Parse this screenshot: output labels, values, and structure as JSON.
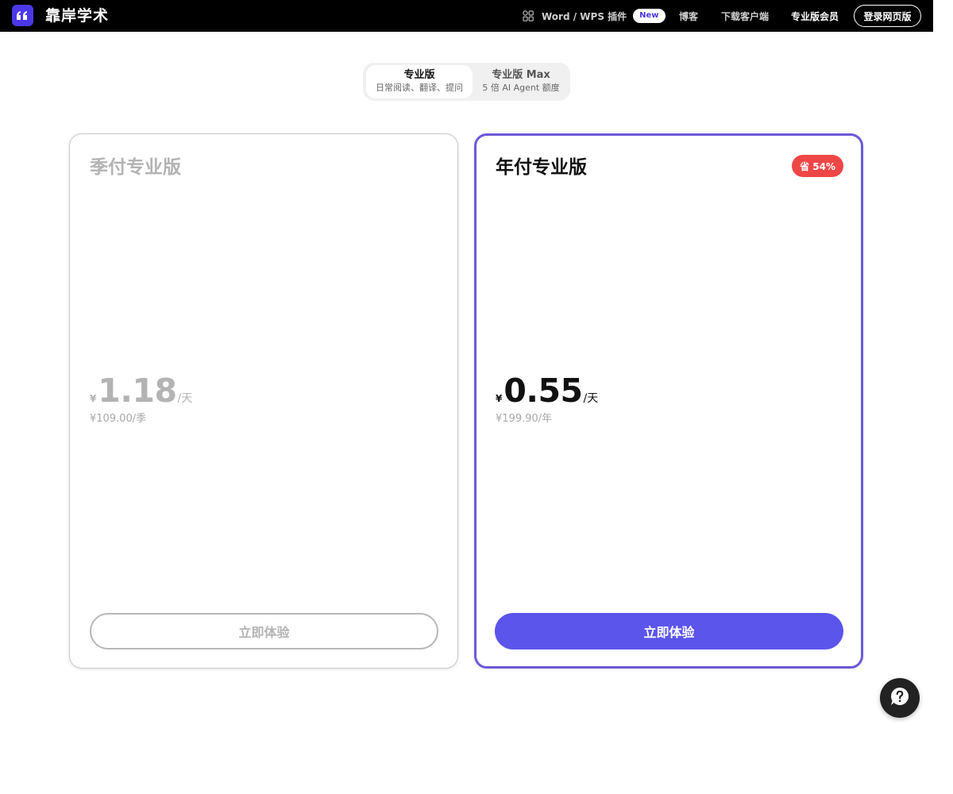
{
  "header": {
    "brand": "靠岸学术",
    "plugin_label": "Word / WPS 插件",
    "plugin_badge": "New",
    "blog": "博客",
    "download": "下载客户端",
    "pro_membership": "专业版会员",
    "login_button": "登录网页版",
    "logo_icon": "quote-icon",
    "plugin_icon": "apps-icon"
  },
  "plan_switch": {
    "tabs": [
      {
        "title": "专业版",
        "subtitle": "日常阅读、翻译、提问",
        "active": true
      },
      {
        "title": "专业版 Max",
        "subtitle": "5 倍 AI Agent 额度",
        "active": false
      }
    ]
  },
  "plans": [
    {
      "title": "季付专业版",
      "currency": "¥",
      "daily_price": "1.18",
      "per_day": "/天",
      "total": "¥109.00/季",
      "cta": "立即体验",
      "highlighted": false
    },
    {
      "title": "年付专业版",
      "badge": "省 54%",
      "currency": "¥",
      "daily_price": "0.55",
      "per_day": "/天",
      "total": "¥199.90/年",
      "cta": "立即体验",
      "highlighted": true
    }
  ],
  "help": {
    "icon": "question-chat-icon"
  },
  "colors": {
    "accent": "#5b55ec",
    "highlight_border": "#6b59d9",
    "save_badge": "#ef4646",
    "logo_bg": "#4b38e6",
    "topbar_bg": "#000000"
  }
}
